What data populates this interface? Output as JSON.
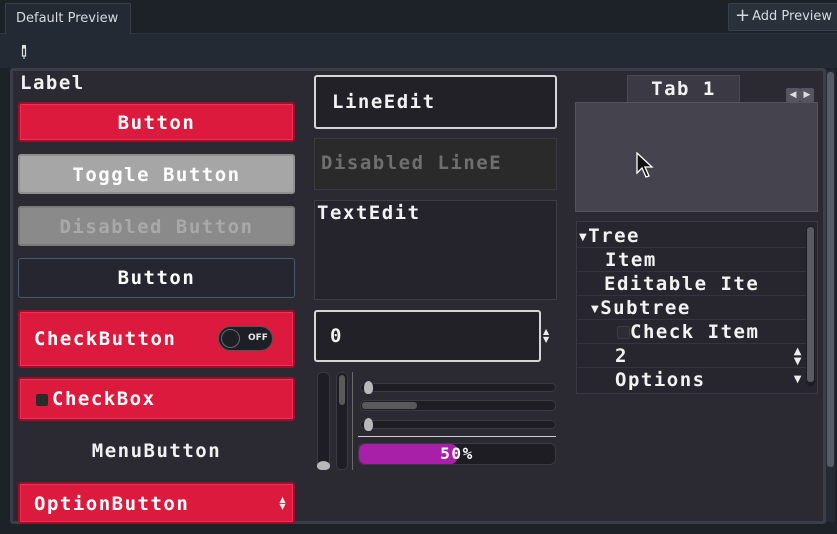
{
  "window": {
    "tab_label": "Default Preview",
    "add_preview_label": "Add Preview"
  },
  "left_column": {
    "label": "Label",
    "button": "Button",
    "toggle_button": "Toggle Button",
    "disabled_button": "Disabled Button",
    "flat_button": "Button",
    "check_button": "CheckButton",
    "check_button_switch": "OFF",
    "checkbox": "CheckBox",
    "menu_button": "MenuButton",
    "option_button": "OptionButton"
  },
  "middle_column": {
    "line_edit": "LineEdit",
    "disabled_line_edit": "Disabled LineE",
    "text_edit": "TextEdit",
    "spinbox_value": "0",
    "progress_value": 50,
    "progress_text": "50%"
  },
  "right_column": {
    "tab_title": "Tab 1",
    "tree": {
      "root": "Tree",
      "item": "Item",
      "editable_item": "Editable Ite",
      "subtree": "Subtree",
      "check_item": "Check Item",
      "range_value": "2",
      "options": "Options"
    }
  },
  "colors": {
    "accent_red": "#dc1a3d",
    "progress_fill": "#a81fa8",
    "panel_bg": "#2b2a33"
  },
  "icons": {
    "pipette": "color-picker-icon",
    "cursor": "mouse-pointer-icon"
  }
}
